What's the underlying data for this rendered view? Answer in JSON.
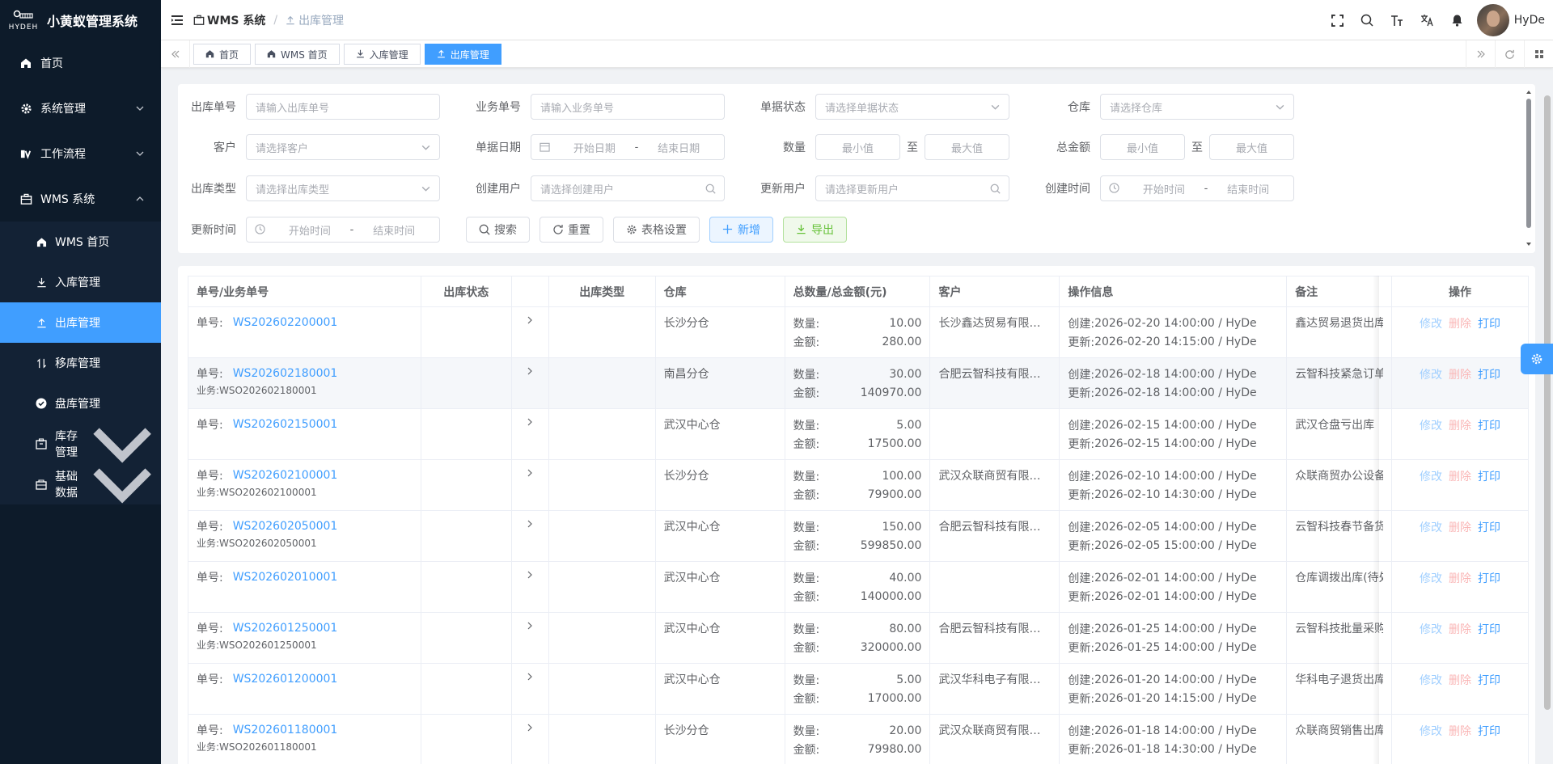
{
  "app": {
    "title": "小黄蚁管理系统",
    "logo_text": "HYDEH"
  },
  "sidebar": {
    "items": [
      {
        "label": "首页",
        "icon": "home-icon"
      },
      {
        "label": "系统管理",
        "icon": "gear-icon"
      },
      {
        "label": "工作流程",
        "icon": "workflow-icon"
      },
      {
        "label": "WMS 系统",
        "icon": "briefcase-icon"
      }
    ],
    "wms_sub": [
      {
        "label": "WMS 首页",
        "icon": "home-icon"
      },
      {
        "label": "入库管理",
        "icon": "download-icon"
      },
      {
        "label": "出库管理",
        "icon": "upload-icon"
      },
      {
        "label": "移库管理",
        "icon": "transfer-icon"
      },
      {
        "label": "盘库管理",
        "icon": "check-circle-icon"
      },
      {
        "label": "库存管理",
        "icon": "box-icon"
      },
      {
        "label": "基础数据",
        "icon": "folder-icon"
      }
    ]
  },
  "header": {
    "breadcrumb_root": "WMS 系统",
    "breadcrumb_current": "出库管理",
    "username": "HyDe"
  },
  "tags": [
    "首页",
    "WMS 首页",
    "入库管理",
    "出库管理"
  ],
  "search": {
    "labels": {
      "out_no": "出库单号",
      "biz_no": "业务单号",
      "doc_status": "单据状态",
      "warehouse": "仓库",
      "customer": "客户",
      "doc_date": "单据日期",
      "quantity": "数量",
      "total_amount": "总金额",
      "out_type": "出库类型",
      "create_user": "创建用户",
      "update_user": "更新用户",
      "create_time": "创建时间",
      "update_time": "更新时间"
    },
    "placeholders": {
      "out_no": "请输入出库单号",
      "biz_no": "请输入业务单号",
      "doc_status": "请选择单据状态",
      "warehouse": "请选择仓库",
      "customer": "请选择客户",
      "out_type": "请选择出库类型",
      "create_user": "请选择创建用户",
      "update_user": "请选择更新用户",
      "start_date": "开始日期",
      "end_date": "结束日期",
      "start_time": "开始时间",
      "end_time": "结束时间",
      "min": "最小值",
      "max": "最大值"
    },
    "range_sep": "-",
    "to": "至",
    "buttons": {
      "search": "搜索",
      "reset": "重置",
      "table_settings": "表格设置",
      "add": "新增",
      "export": "导出"
    }
  },
  "table": {
    "columns": [
      "单号/业务单号",
      "出库状态",
      "",
      "出库类型",
      "仓库",
      "总数量/总金额(元)",
      "客户",
      "操作信息",
      "备注",
      "操作"
    ],
    "labels": {
      "no": "单号:",
      "biz": "业务:",
      "qty": "数量:",
      "amount": "金额:",
      "created": "创建:",
      "updated": "更新:"
    },
    "actions": {
      "edit": "修改",
      "delete": "删除",
      "print": "打印"
    },
    "rows": [
      {
        "no": "WS202602200001",
        "biz": "",
        "warehouse": "长沙分仓",
        "qty": "10.00",
        "amount": "280.00",
        "customer": "长沙鑫达贸易有限…",
        "created": "2026-02-20 14:00:00 / HyDe",
        "updated": "2026-02-20 14:15:00 / HyDe",
        "remark": "鑫达贸易退货出库"
      },
      {
        "no": "WS202602180001",
        "biz": "WSO202602180001",
        "warehouse": "南昌分仓",
        "qty": "30.00",
        "amount": "140970.00",
        "customer": "合肥云智科技有限…",
        "created": "2026-02-18 14:00:00 / HyDe",
        "updated": "2026-02-18 14:00:00 / HyDe",
        "remark": "云智科技紧急订单("
      },
      {
        "no": "WS202602150001",
        "biz": "",
        "warehouse": "武汉中心仓",
        "qty": "5.00",
        "amount": "17500.00",
        "customer": "",
        "created": "2026-02-15 14:00:00 / HyDe",
        "updated": "2026-02-15 14:00:00 / HyDe",
        "remark": "武汉仓盘亏出库"
      },
      {
        "no": "WS202602100001",
        "biz": "WSO202602100001",
        "warehouse": "长沙分仓",
        "qty": "100.00",
        "amount": "79900.00",
        "customer": "武汉众联商贸有限…",
        "created": "2026-02-10 14:00:00 / HyDe",
        "updated": "2026-02-10 14:30:00 / HyDe",
        "remark": "众联商贸办公设备"
      },
      {
        "no": "WS202602050001",
        "biz": "WSO202602050001",
        "warehouse": "武汉中心仓",
        "qty": "150.00",
        "amount": "599850.00",
        "customer": "合肥云智科技有限…",
        "created": "2026-02-05 14:00:00 / HyDe",
        "updated": "2026-02-05 15:00:00 / HyDe",
        "remark": "云智科技春节备货"
      },
      {
        "no": "WS202602010001",
        "biz": "",
        "warehouse": "武汉中心仓",
        "qty": "40.00",
        "amount": "140000.00",
        "customer": "",
        "created": "2026-02-01 14:00:00 / HyDe",
        "updated": "2026-02-01 14:00:00 / HyDe",
        "remark": "仓库调拨出库(待处"
      },
      {
        "no": "WS202601250001",
        "biz": "WSO202601250001",
        "warehouse": "武汉中心仓",
        "qty": "80.00",
        "amount": "320000.00",
        "customer": "合肥云智科技有限…",
        "created": "2026-01-25 14:00:00 / HyDe",
        "updated": "2026-01-25 14:00:00 / HyDe",
        "remark": "云智科技批量采购("
      },
      {
        "no": "WS202601200001",
        "biz": "",
        "warehouse": "武汉中心仓",
        "qty": "5.00",
        "amount": "17000.00",
        "customer": "武汉华科电子有限…",
        "created": "2026-01-20 14:00:00 / HyDe",
        "updated": "2026-01-20 14:15:00 / HyDe",
        "remark": "华科电子退货出库"
      },
      {
        "no": "WS202601180001",
        "biz": "WSO202601180001",
        "warehouse": "长沙分仓",
        "qty": "20.00",
        "amount": "79980.00",
        "customer": "武汉众联商贸有限…",
        "created": "2026-01-18 14:00:00 / HyDe",
        "updated": "2026-01-18 14:30:00 / HyDe",
        "remark": "众联商贸销售出库"
      }
    ]
  },
  "colors": {
    "sidebar_bg": "#0d1b2a",
    "accent": "#409eff",
    "danger_light": "#fab6b6",
    "success": "#67c23a"
  }
}
